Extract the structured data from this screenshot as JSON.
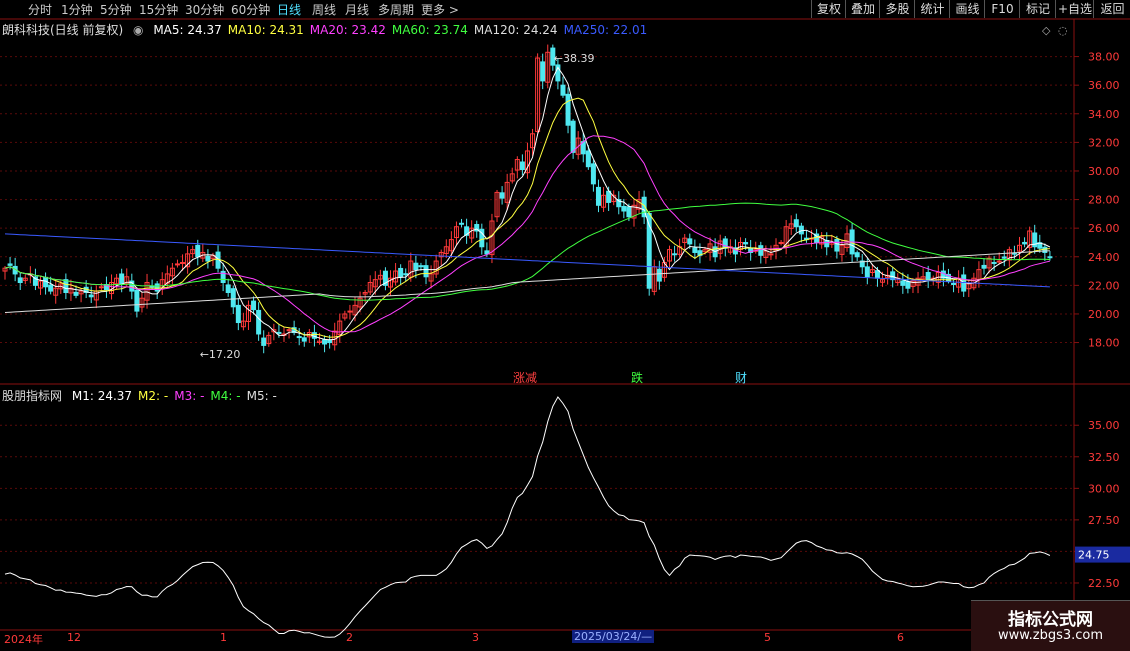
{
  "periods": [
    "分时",
    "1分钟",
    "5分钟",
    "15分钟",
    "30分钟",
    "60分钟",
    "日线",
    "周线",
    "月线",
    "多周期",
    "更多 >"
  ],
  "active_period": "日线",
  "toolbar": [
    "复权",
    "叠加",
    "多股",
    "统计",
    "画线",
    "F10",
    "标记",
    "+自选",
    "返回"
  ],
  "legend_top": {
    "title": "朗科科技(日线 前复权)",
    "items": [
      {
        "text": "MA5: 24.37",
        "color": "#ffffff"
      },
      {
        "text": "MA10: 24.31",
        "color": "#ffff40"
      },
      {
        "text": "MA20: 23.42",
        "color": "#ff40ff"
      },
      {
        "text": "MA60: 23.74",
        "color": "#40ff40"
      },
      {
        "text": "MA120: 24.24",
        "color": "#dddddd"
      },
      {
        "text": "MA250: 22.01",
        "color": "#3a5aff"
      }
    ]
  },
  "legend_bottom": {
    "title": "股朋指标网",
    "items": [
      {
        "text": "M1: 24.37",
        "color": "#ffffff"
      },
      {
        "text": "M2: -",
        "color": "#ffff40"
      },
      {
        "text": "M3: -",
        "color": "#ff40ff"
      },
      {
        "text": "M4: -",
        "color": "#40ff40"
      },
      {
        "text": "M5: -",
        "color": "#dddddd"
      }
    ]
  },
  "annotations": {
    "high": "38.39",
    "low": "17.20",
    "events": [
      {
        "text": "涨减",
        "color": "#ff4040"
      },
      {
        "text": "跌",
        "color": "#40ff40"
      },
      {
        "text": "财",
        "color": "#4fe0ff"
      }
    ]
  },
  "current_value": "24.75",
  "dates": [
    "2024年",
    "12",
    "1",
    "2",
    "3",
    "5",
    "6"
  ],
  "date_cursor": "2025/03/24/—",
  "watermark": {
    "line1": "指标公式网",
    "line2": "www.zbgs3.com"
  },
  "chart_data": [
    {
      "type": "candlestick",
      "title": "朗科科技(日线 前复权)",
      "y_ticks": [
        18.0,
        20.0,
        22.0,
        24.0,
        26.0,
        28.0,
        30.0,
        32.0,
        34.0,
        36.0,
        38.0
      ],
      "ylim": [
        16.5,
        39.3
      ],
      "close": [
        23.2,
        23.4,
        22.8,
        22.2,
        22.5,
        22.8,
        22.0,
        22.3,
        21.9,
        21.6,
        21.8,
        22.1,
        21.5,
        21.8,
        21.3,
        21.6,
        21.5,
        21.2,
        21.6,
        21.9,
        21.7,
        22.2,
        22.5,
        22.1,
        22.6,
        21.6,
        20.2,
        21.1,
        22.2,
        21.9,
        21.6,
        22.4,
        22.8,
        23.2,
        23.5,
        23.6,
        24.2,
        24.5,
        24.0,
        24.3,
        23.7,
        24.1,
        23.2,
        22.2,
        21.5,
        20.5,
        19.4,
        19.5,
        20.6,
        20.3,
        18.6,
        17.8,
        18.5,
        18.9,
        18.7,
        18.6,
        18.9,
        18.7,
        18.4,
        18.1,
        18.7,
        18.3,
        18.1,
        17.9,
        18.0,
        18.8,
        19.5,
        20.0,
        20.2,
        20.6,
        21.1,
        21.5,
        22.2,
        22.4,
        22.7,
        22.0,
        22.5,
        23.0,
        22.6,
        22.8,
        23.7,
        23.1,
        23.3,
        22.6,
        22.8,
        23.7,
        24.3,
        24.7,
        25.2,
        26.1,
        26.3,
        25.5,
        26.0,
        25.8,
        24.7,
        24.2,
        26.5,
        28.5,
        28.1,
        29.2,
        29.8,
        30.8,
        30.1,
        31.4,
        32.6,
        37.9,
        36.3,
        38.3,
        37.4,
        36.3,
        35.3,
        33.2,
        31.3,
        32.3,
        31.2,
        30.3,
        29.1,
        27.6,
        28.3,
        27.8,
        28.3,
        27.5,
        27.2,
        26.8,
        27.6,
        28.0,
        26.8,
        21.8,
        23.3,
        22.3,
        23.6,
        24.5,
        24.2,
        24.7,
        25.3,
        24.9,
        24.3,
        24.1,
        24.5,
        24.9,
        24.0,
        25.1,
        24.6,
        24.7,
        24.2,
        25.0,
        24.9,
        24.3,
        24.5,
        24.1,
        24.4,
        24.2,
        24.8,
        25.0,
        26.1,
        26.3,
        26.1,
        25.6,
        25.2,
        25.3,
        25.0,
        25.4,
        24.7,
        25.0,
        24.4,
        24.8,
        25.6,
        24.2,
        24.0,
        23.3,
        22.6,
        23.1,
        22.5,
        22.4,
        22.7,
        22.4,
        22.5,
        22.0,
        21.8,
        22.3,
        22.5,
        22.6,
        22.4,
        22.5,
        22.9,
        22.5,
        22.3,
        22.1,
        22.5,
        21.6,
        22.1,
        22.5,
        23.1,
        23.2,
        23.9,
        23.6,
        23.7,
        23.9,
        24.5,
        24.2,
        24.8,
        24.9,
        25.8,
        24.7,
        24.6,
        24.3,
        24.0
      ],
      "ma": [
        {
          "name": "MA5",
          "color": "#ffffff"
        },
        {
          "name": "MA10",
          "color": "#ffff40"
        },
        {
          "name": "MA20",
          "color": "#ff40ff"
        },
        {
          "name": "MA60",
          "color": "#40ff40"
        },
        {
          "name": "MA120",
          "color": "#dddddd"
        },
        {
          "name": "MA250",
          "color": "#3a5aff"
        }
      ]
    },
    {
      "type": "line",
      "title": "股朋指标网",
      "series": [
        {
          "name": "M1",
          "color": "#ffffff"
        }
      ],
      "y_ticks": [
        22.5,
        25.0,
        27.5,
        30.0,
        32.5,
        35.0
      ],
      "ylim": [
        20.2,
        37.0
      ]
    }
  ]
}
